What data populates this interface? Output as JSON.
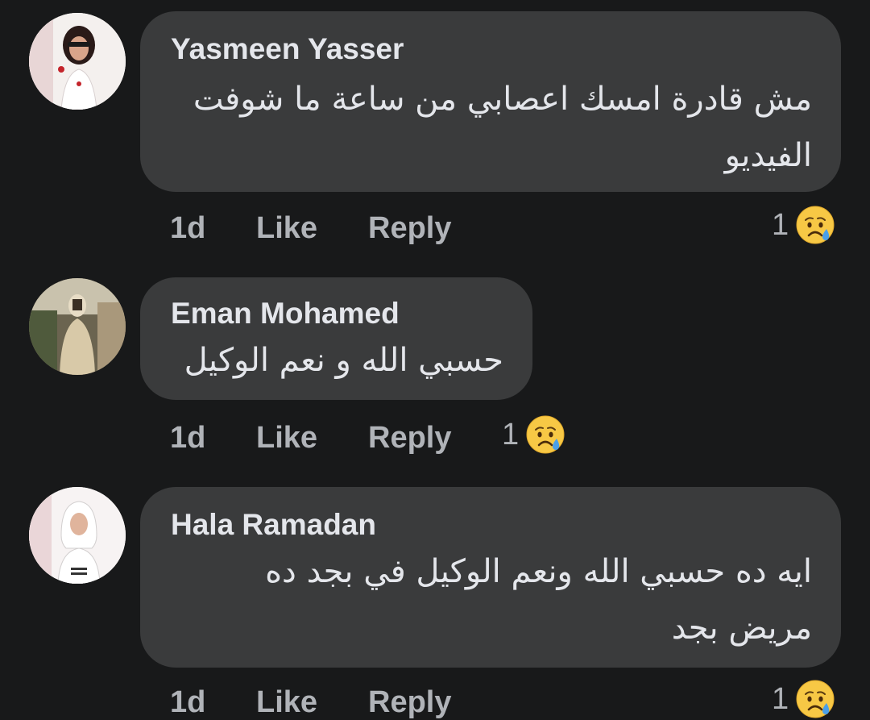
{
  "comments": [
    {
      "author": "Yasmeen Yasser",
      "text_line1": "مش قادرة امسك اعصابي من ساعة ما شوفت",
      "text_line2": "الفيديو",
      "time": "1d",
      "like_label": "Like",
      "reply_label": "Reply",
      "reaction_count": "1",
      "reaction_icon": "crying-face-icon"
    },
    {
      "author": "Eman Mohamed",
      "text_line1": "حسبي الله و نعم الوكيل",
      "time": "1d",
      "like_label": "Like",
      "reply_label": "Reply",
      "reaction_count": "1",
      "reaction_icon": "crying-face-icon"
    },
    {
      "author": "Hala Ramadan",
      "text_line1": "ايه ده حسبي الله ونعم الوكيل في بجد ده",
      "text_line2": "مريض بجد",
      "time": "1d",
      "like_label": "Like",
      "reply_label": "Reply",
      "reaction_count": "1",
      "reaction_icon": "crying-face-icon"
    }
  ],
  "colors": {
    "background": "#18191a",
    "bubble": "#3a3b3c",
    "primary_text": "#e4e6eb",
    "secondary_text": "#b0b3b8",
    "emoji_yellow": "#f7c845",
    "tear_blue": "#4a9fe8"
  }
}
